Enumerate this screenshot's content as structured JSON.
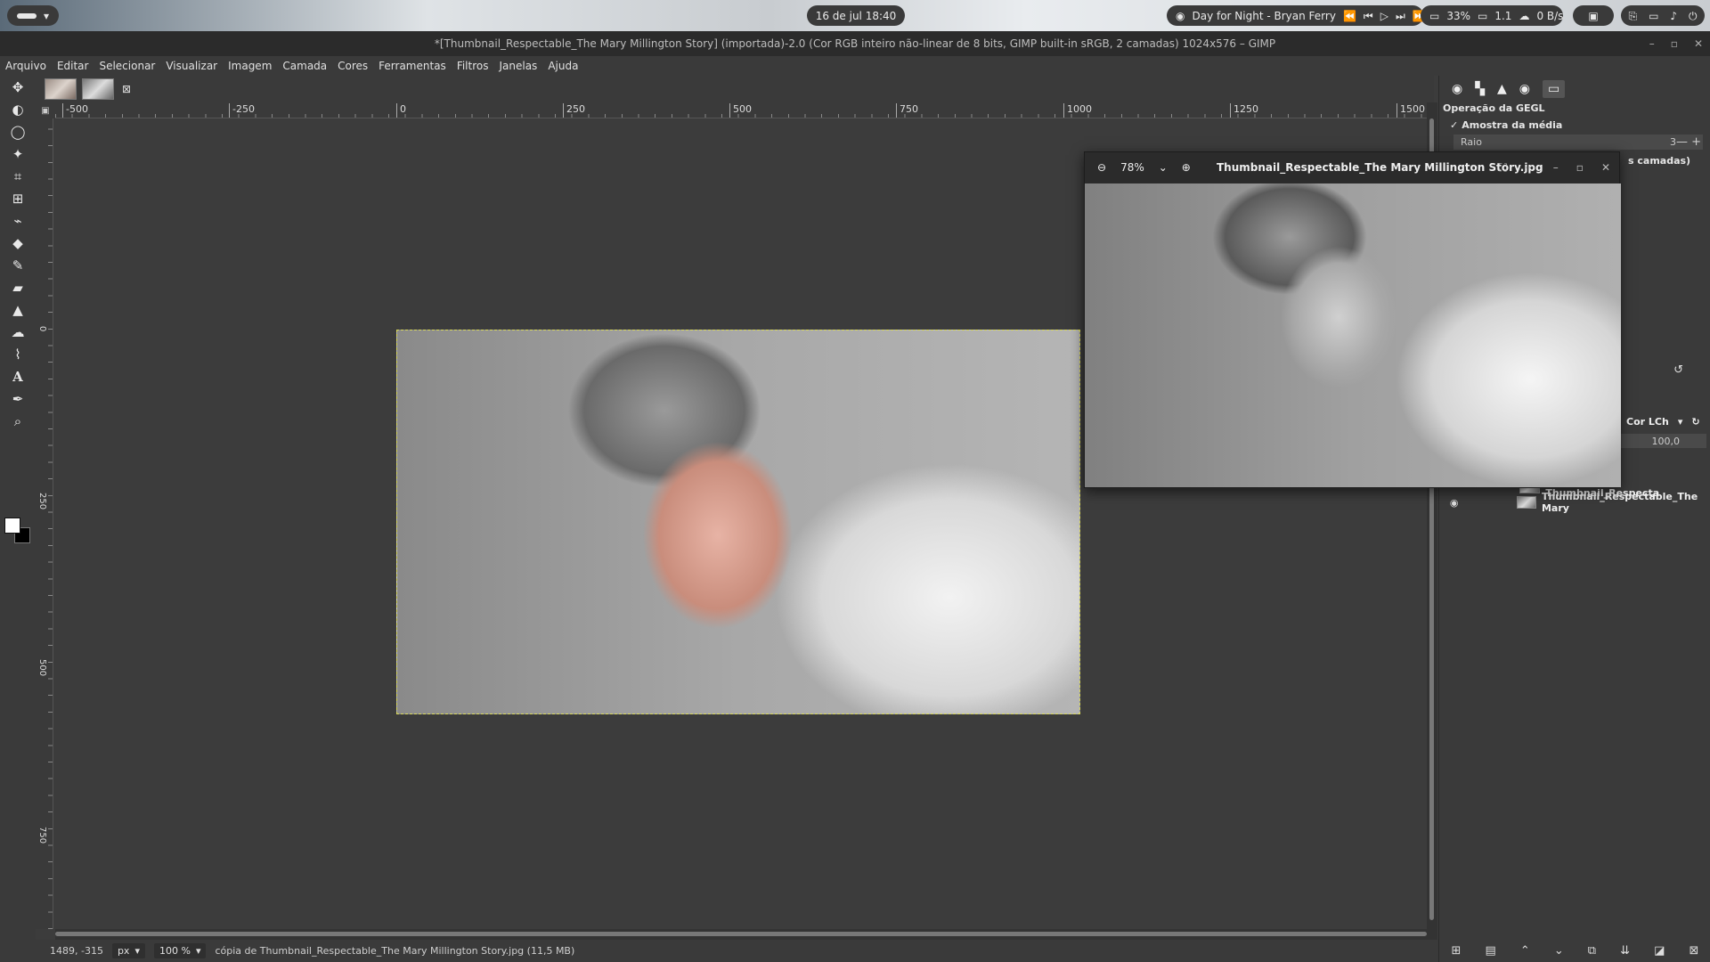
{
  "system": {
    "clock": "16 de jul  18:40",
    "media": "Day for Night - Bryan Ferry",
    "cpu": "33%",
    "load": "1.1",
    "net": "0 B/s"
  },
  "window": {
    "title": "*[Thumbnail_Respectable_The Mary Millington Story] (importada)-2.0 (Cor RGB inteiro não-linear de 8 bits, GIMP built-in sRGB, 2 camadas) 1024x576 – GIMP"
  },
  "menu": [
    "Arquivo",
    "Editar",
    "Selecionar",
    "Visualizar",
    "Imagem",
    "Camada",
    "Cores",
    "Ferramentas",
    "Filtros",
    "Janelas",
    "Ajuda"
  ],
  "ruler": {
    "h": [
      "-500",
      "-250",
      "0",
      "250",
      "500",
      "750",
      "1000",
      "1250",
      "1500"
    ],
    "v": [
      "0",
      "250",
      "500",
      "750"
    ]
  },
  "status": {
    "coords": "1489, -315",
    "unit": "px",
    "zoom": "100 %",
    "message": "cópia de Thumbnail_Respectable_The Mary Millington Story.jpg (11,5 MB)"
  },
  "dock": {
    "gegl_title": "Operação da GEGL",
    "sample_average": "Amostra da média",
    "radius_label": "Raio",
    "radius_value": "3",
    "layers_fragment": "s camadas)",
    "mode": "Cor LCh",
    "opacity": "100,0",
    "layers": [
      {
        "name": "Cópia de Thumbnail_Respecta",
        "visible": false
      },
      {
        "name": "Thumbnail_Respectable_The Mary",
        "visible": true
      }
    ]
  },
  "viewer": {
    "zoom": "78%",
    "title": "Thumbnail_Respectable_The Mary Millington Story.jpg"
  },
  "icons": {
    "tools": [
      "move-icon",
      "warp-icon",
      "lasso-icon",
      "fuzzy-select-icon",
      "crop-icon",
      "transform-icon",
      "warp-transform-icon",
      "bucket-fill-icon",
      "paintbrush-icon",
      "eraser-icon",
      "clone-icon",
      "smudge-icon",
      "paths-icon",
      "text-icon",
      "color-picker-icon",
      "zoom-icon"
    ]
  }
}
